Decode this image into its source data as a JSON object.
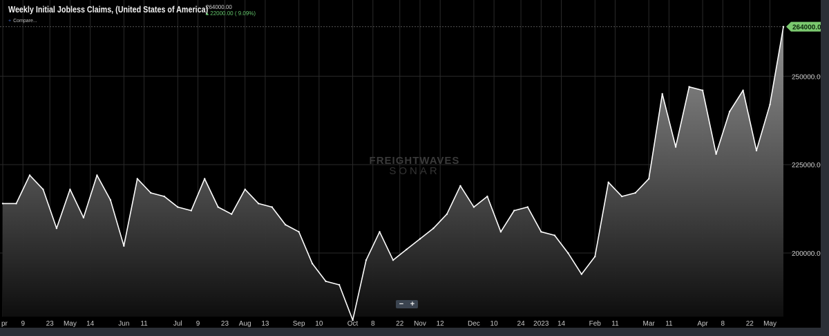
{
  "header": {
    "title": "Weekly Initial Jobless Claims, (United States of America)",
    "last_value": "264000.00",
    "change": "▴ 22000.00 ( 9.09%)",
    "compare_label": "Compare..."
  },
  "watermark": {
    "line1": "FREIGHTWAVES",
    "line2": "SONAR"
  },
  "zoom": {
    "minus": "−",
    "plus": "+"
  },
  "colors": {
    "line": "#ffffff",
    "badge": "#7bc96f",
    "change": "#62c36a",
    "grid": "#2a2a2a"
  },
  "chart_data": {
    "type": "area",
    "title": "Weekly Initial Jobless Claims, (United States of America)",
    "grid": true,
    "y_axis_position": "right",
    "ylim": [
      182000,
      270000
    ],
    "y_ticks": [
      200000,
      225000,
      250000
    ],
    "y_tick_labels": [
      "200000.00",
      "225000.00",
      "250000.00"
    ],
    "last_value_label": "264000.00",
    "x_tick_labels": [
      "pr",
      "9",
      "23",
      "May",
      "14",
      "Jun",
      "11",
      "Jul",
      "9",
      "23",
      "Aug",
      "13",
      "Sep",
      "10",
      "Oct",
      "8",
      "22",
      "Nov",
      "12",
      "Dec",
      "10",
      "24",
      "2023",
      "14",
      "Feb",
      "11",
      "Mar",
      "11",
      "Apr",
      "8",
      "22",
      "May"
    ],
    "x_tick_index": [
      0,
      1.5,
      3.5,
      5,
      6.5,
      9,
      10.5,
      13,
      14.5,
      16.5,
      18,
      19.5,
      22,
      23.5,
      26,
      27.5,
      29.5,
      31,
      32.5,
      35,
      36.5,
      38.5,
      40,
      41.5,
      44,
      45.5,
      48,
      49.5,
      52,
      53.5,
      55.5,
      57
    ],
    "series": [
      {
        "values": [
          214000,
          214000,
          222000,
          218000,
          207000,
          218000,
          210000,
          222000,
          215000,
          202000,
          221000,
          217000,
          216000,
          213000,
          212000,
          221000,
          213000,
          211000,
          218000,
          214000,
          213000,
          208000,
          206000,
          197000,
          192000,
          191000,
          181000,
          198000,
          206000,
          198000,
          201000,
          204000,
          207000,
          211000,
          219000,
          213000,
          216000,
          206000,
          212000,
          213000,
          206000,
          205000,
          200000,
          194000,
          199000,
          220000,
          216000,
          217000,
          221000,
          245000,
          230000,
          247000,
          246000,
          228000,
          240000,
          246000,
          229000,
          242000,
          264000
        ]
      }
    ]
  }
}
